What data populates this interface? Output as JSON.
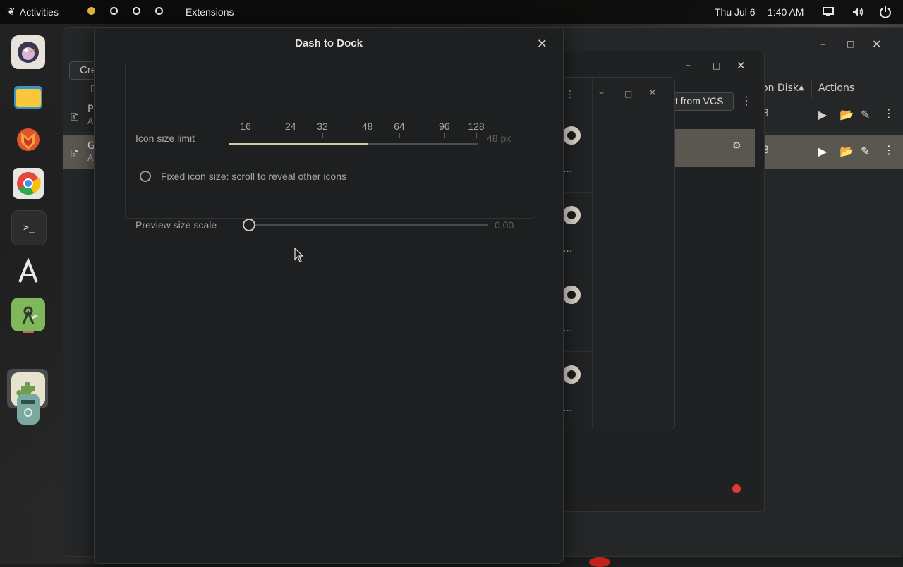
{
  "topbar": {
    "activities": "Activities",
    "app_name": "Extensions",
    "date": "Thu Jul 6",
    "time": "1:40 AM",
    "active_workspace_color": "#e0b23c"
  },
  "back_window": {
    "create_label": "Cre",
    "col_d": "D",
    "row1_title": "P",
    "row1_sub": "A",
    "row2_title": "G",
    "row2_sub": "A",
    "sort_label": "on Disk",
    "actions_label": "Actions",
    "row1_count": "8",
    "row2_count": "8"
  },
  "middle_window": {
    "button_label": "t from VCS",
    "dots_label": "..."
  },
  "dialog": {
    "title": "Dash to Dock",
    "icon_size_label": "Icon size limit",
    "icon_size_marks": [
      "16",
      "24",
      "32",
      "48",
      "64",
      "96",
      "128"
    ],
    "icon_size_value": "48 px",
    "icon_size_value_num": 48,
    "fixed_icon_label": "Fixed icon size: scroll to reveal other icons",
    "preview_label": "Preview size scale",
    "preview_value": "0.00",
    "preview_value_num": 0
  },
  "accent_color": "#d8c8a0",
  "error_color": "#e03b2e"
}
